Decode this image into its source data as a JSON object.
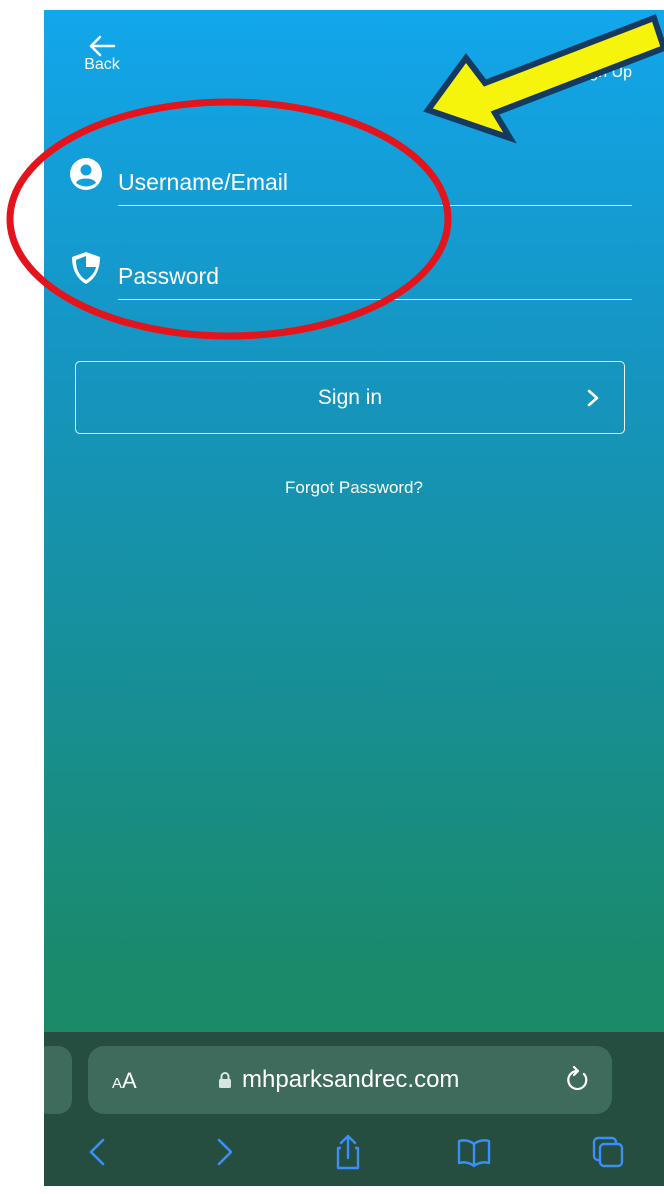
{
  "header": {
    "back_label": "Back",
    "signup_label": "Sign Up"
  },
  "form": {
    "username_placeholder": "Username/Email",
    "password_placeholder": "Password",
    "signin_label": "Sign in",
    "forgot_label": "Forgot Password?"
  },
  "browser": {
    "text_size_small": "A",
    "text_size_large": "A",
    "url": "mhparksandrec.com"
  },
  "icons": {
    "back": "arrow-left-icon",
    "user": "user-circle-icon",
    "password": "shield-icon",
    "signin_chevron": "chevron-right-icon",
    "lock": "lock-icon",
    "reload": "reload-icon",
    "nav_back": "chevron-left-icon",
    "nav_forward": "chevron-right-icon",
    "share": "share-icon",
    "bookmarks": "book-icon",
    "tabs": "tabs-icon"
  },
  "annotations": {
    "ellipse_color": "#e3141c",
    "arrow_fill": "#f7f40c",
    "arrow_outline": "#163a5f"
  },
  "colors": {
    "gradient_top": "#12a6eb",
    "gradient_bottom": "#1c8a5e",
    "toolbar": "#254d40",
    "safari_blue": "#3b8ff5"
  }
}
